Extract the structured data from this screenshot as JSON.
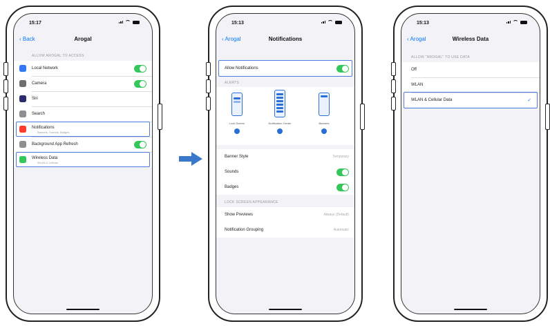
{
  "phone1": {
    "time": "15:17",
    "back": "Back",
    "title": "Arogal",
    "section": "ALLOW AROGAL TO ACCESS",
    "items": [
      {
        "label": "Local Network",
        "color": "#3478f6",
        "toggle": true
      },
      {
        "label": "Camera",
        "color": "#6e6e73",
        "toggle": true
      },
      {
        "label": "Siri",
        "color": "#2c2c6e",
        "toggle": false
      },
      {
        "label": "Search",
        "color": "#8e8e93",
        "toggle": false
      },
      {
        "label": "Notifications",
        "sub": "Banners, Sounds, Badges",
        "color": "#ff3b30",
        "toggle": false
      },
      {
        "label": "Background App Refresh",
        "color": "#8e8e93",
        "toggle": true
      },
      {
        "label": "Wireless Data",
        "sub": "WLAN & Cellular",
        "color": "#34c759",
        "toggle": false
      }
    ]
  },
  "phone2": {
    "time": "15:13",
    "back": "Arogal",
    "title": "Notifications",
    "allow": "Allow Notifications",
    "alerts_label": "ALERTS",
    "styles": [
      "Lock Screen",
      "Notification Center",
      "Banners"
    ],
    "rows": [
      {
        "label": "Banner Style",
        "value": "Temporary"
      },
      {
        "label": "Sounds",
        "toggle": true
      },
      {
        "label": "Badges",
        "toggle": true
      }
    ],
    "lock_label": "LOCK SCREEN APPEARANCE",
    "rows2": [
      {
        "label": "Show Previews",
        "value": "Always (Default)"
      },
      {
        "label": "Notification Grouping",
        "value": "Automatic"
      }
    ]
  },
  "phone3": {
    "time": "15:13",
    "back": "Arogal",
    "title": "Wireless Data",
    "section": "ALLOW \"AROGAL\" TO USE DATA",
    "options": [
      "Off",
      "WLAN",
      "WLAN & Cellular Data"
    ],
    "check": "✓"
  }
}
